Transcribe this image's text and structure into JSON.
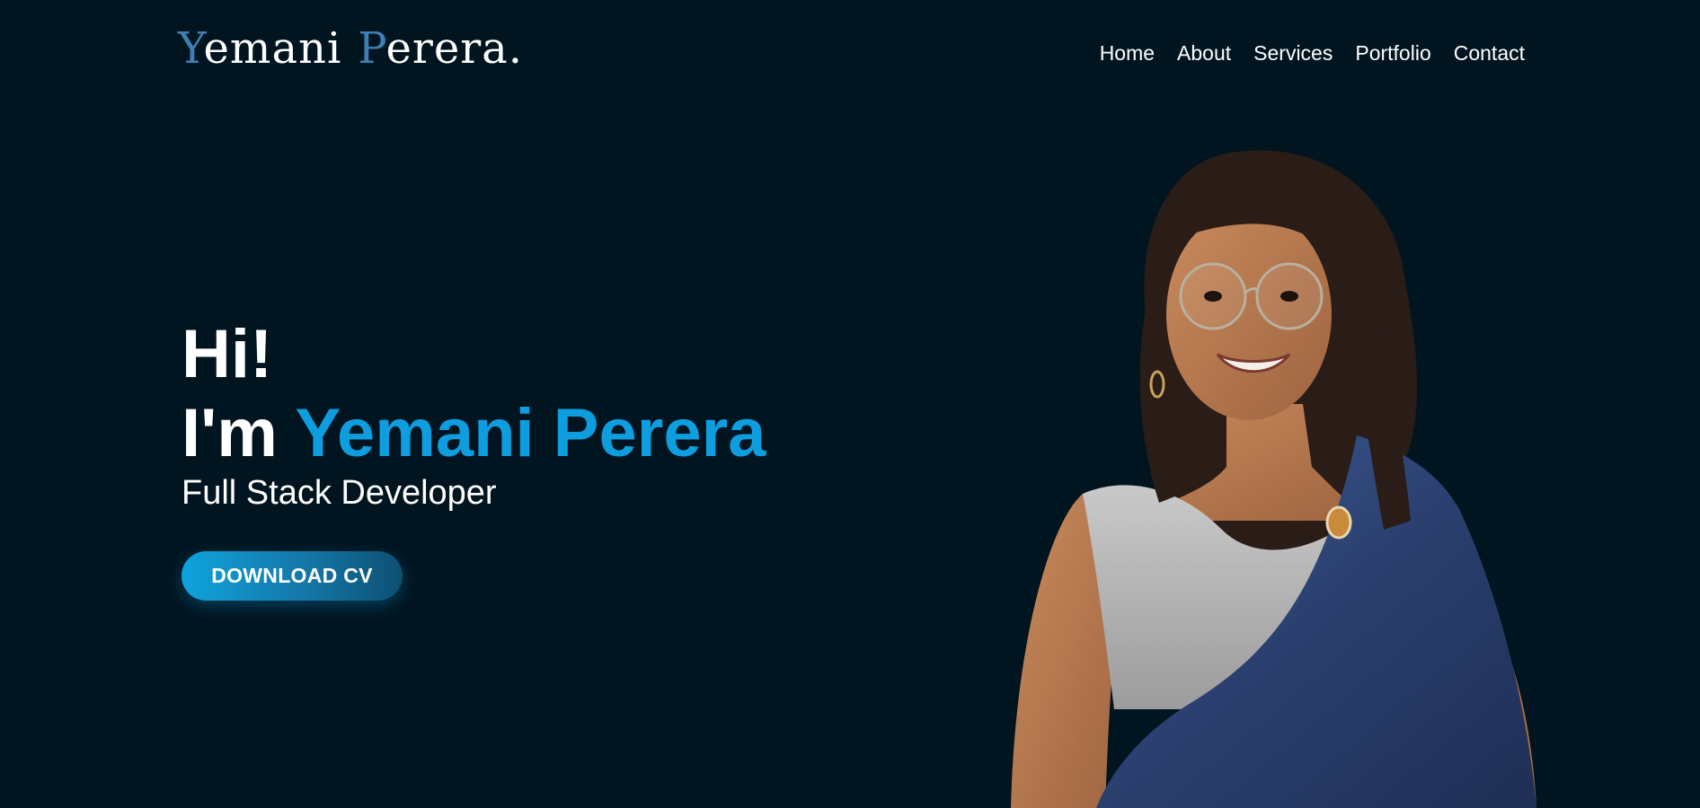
{
  "header": {
    "logo": {
      "first_initial": "Y",
      "first_rest": "emani",
      "last_initial": "P",
      "last_rest": "erera."
    },
    "nav": [
      {
        "label": "Home"
      },
      {
        "label": "About"
      },
      {
        "label": "Services"
      },
      {
        "label": "Portfolio"
      },
      {
        "label": "Contact"
      }
    ]
  },
  "hero": {
    "greeting": "Hi!",
    "intro_prefix": "I'm ",
    "name": "Yemani Perera",
    "role": "Full Stack Developer",
    "cv_button": "DOWNLOAD CV"
  },
  "portrait": {
    "icon": "profile-photo"
  },
  "colors": {
    "background": "#001520",
    "accent": "#0e9ee0",
    "logo_accent": "#3f7fb5"
  }
}
